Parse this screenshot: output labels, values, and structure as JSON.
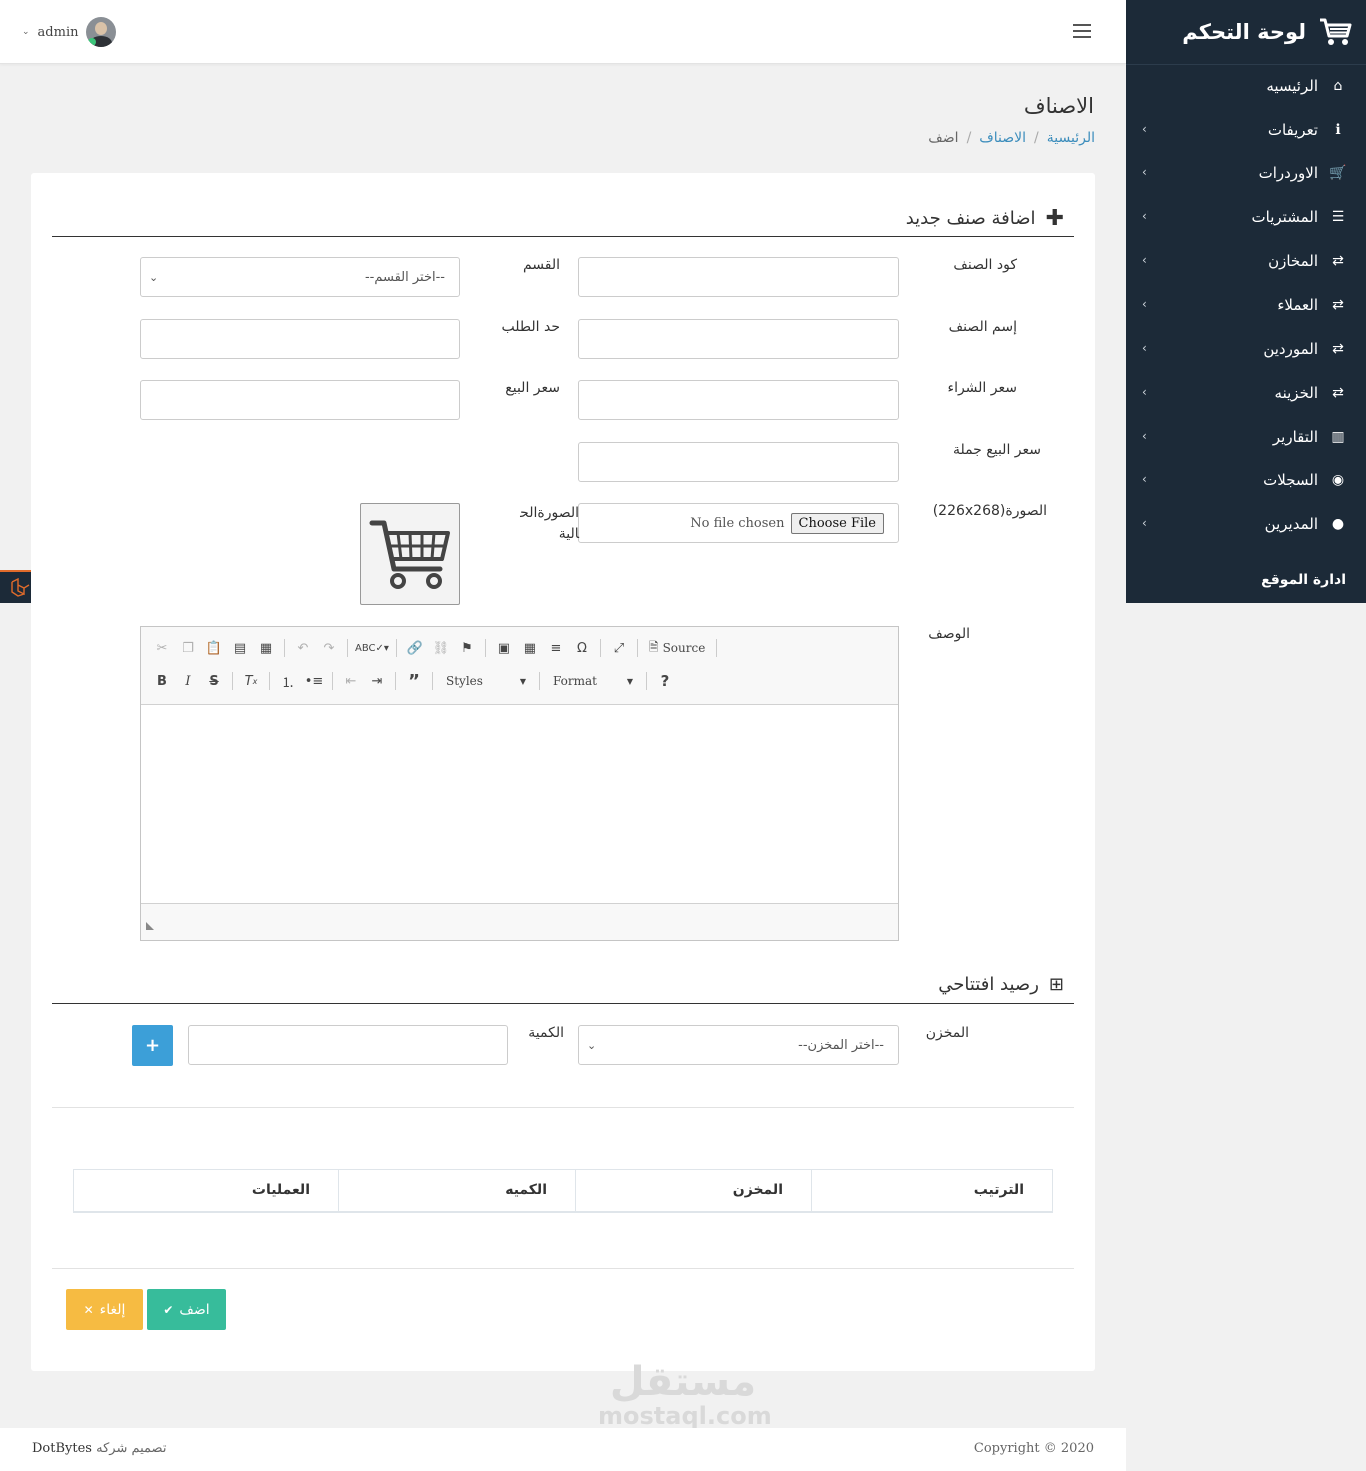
{
  "sidebar": {
    "brand_title": "لوحة التحكم",
    "items": [
      {
        "label": "الرئيسيه",
        "icon": "home-icon",
        "glyph": "⌂",
        "has_children": false
      },
      {
        "label": "تعريفات",
        "icon": "info-icon",
        "glyph": "ℹ",
        "has_children": true
      },
      {
        "label": "الاوردرات",
        "icon": "cart-icon",
        "glyph": "🛒",
        "has_children": true
      },
      {
        "label": "المشتريات",
        "icon": "list-icon",
        "glyph": "☰",
        "has_children": true
      },
      {
        "label": "المخازن",
        "icon": "exchange-icon",
        "glyph": "⇄",
        "has_children": true
      },
      {
        "label": "العملاء",
        "icon": "exchange-icon",
        "glyph": "⇄",
        "has_children": true
      },
      {
        "label": "الموردين",
        "icon": "exchange-icon",
        "glyph": "⇄",
        "has_children": true
      },
      {
        "label": "الخزينه",
        "icon": "exchange-icon",
        "glyph": "⇄",
        "has_children": true
      },
      {
        "label": "التقارير",
        "icon": "bar-chart-icon",
        "glyph": "▥",
        "has_children": true
      },
      {
        "label": "السجلات",
        "icon": "eye-icon",
        "glyph": "◉",
        "has_children": true
      },
      {
        "label": "المديرين",
        "icon": "user-icon",
        "glyph": "●",
        "has_children": true
      }
    ],
    "footer_label": "ادارة الموقع"
  },
  "header": {
    "username": "admin"
  },
  "page": {
    "title": "الاصناف",
    "breadcrumb": {
      "home": "الرئيسية",
      "section": "الاصناف",
      "current": "اضف"
    }
  },
  "form": {
    "section_title": "اضافة صنف جديد",
    "fields": {
      "code_label": "كود الصنف",
      "category_label": "القسم",
      "category_value": "--اختر القسم--",
      "name_label": "إسم الصنف",
      "order_limit_label": "حد الطلب",
      "purchase_price_label": "سعر الشراء",
      "sale_price_label": "سعر البيع",
      "wholesale_price_label": "سعر البيع جملة",
      "image_label": "الصورة(226x268)",
      "file_button": "Choose File",
      "file_status": "No file chosen",
      "current_image_label": "الصورةالحالية",
      "description_label": "الوصف"
    },
    "editor": {
      "source_label": "Source",
      "styles_label": "Styles",
      "format_label": "Format"
    },
    "opening": {
      "section_title": "رصيد افتتاحي",
      "warehouse_label": "المخزن",
      "warehouse_value": "--اختر المخزن--",
      "quantity_label": "الكمية",
      "add_button": "+"
    },
    "table": {
      "columns": [
        "الترتيب",
        "المخزن",
        "الكميه",
        "العمليات"
      ]
    },
    "buttons": {
      "submit": "اضف",
      "cancel": "إلغاء"
    }
  },
  "footer": {
    "design_text": "تصميم شركه",
    "company": "DotBytes",
    "copyright": "Copyright © 2020"
  },
  "watermark": {
    "arabic": "مستقل",
    "latin": "mostaql.com"
  },
  "colors": {
    "sidebar_bg": "#1c2a38",
    "link": "#3c8dbc",
    "primary_blue": "#3c9fd8",
    "success": "#37bc9b",
    "warning": "#f6bb42"
  }
}
